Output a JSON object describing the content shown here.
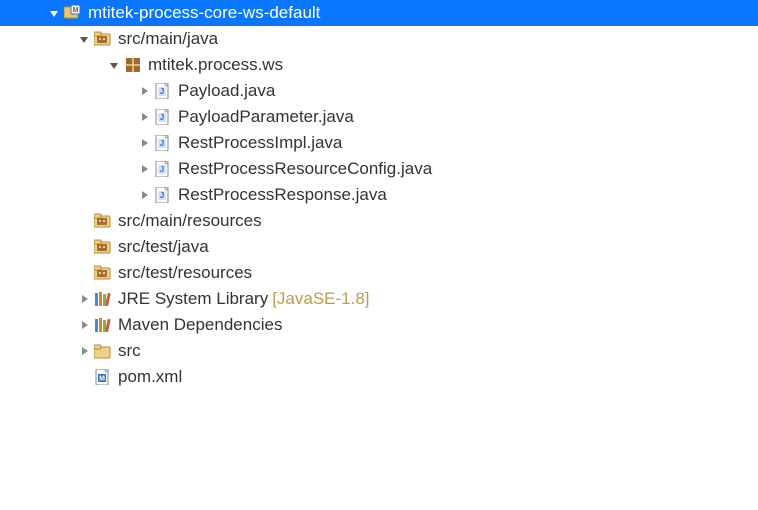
{
  "project": {
    "name": "mtitek-process-core-ws-default"
  },
  "srcFolders": {
    "mainJava": "src/main/java",
    "mainResources": "src/main/resources",
    "testJava": "src/test/java",
    "testResources": "src/test/resources"
  },
  "package": {
    "name": "mtitek.process.ws"
  },
  "javaFiles": {
    "f0": "Payload.java",
    "f1": "PayloadParameter.java",
    "f2": "RestProcessImpl.java",
    "f3": "RestProcessResourceConfig.java",
    "f4": "RestProcessResponse.java"
  },
  "libraries": {
    "jre": "JRE System Library",
    "jreAnno": "[JavaSE-1.8]",
    "maven": "Maven Dependencies"
  },
  "folder": {
    "src": "src"
  },
  "files": {
    "pom": "pom.xml"
  }
}
